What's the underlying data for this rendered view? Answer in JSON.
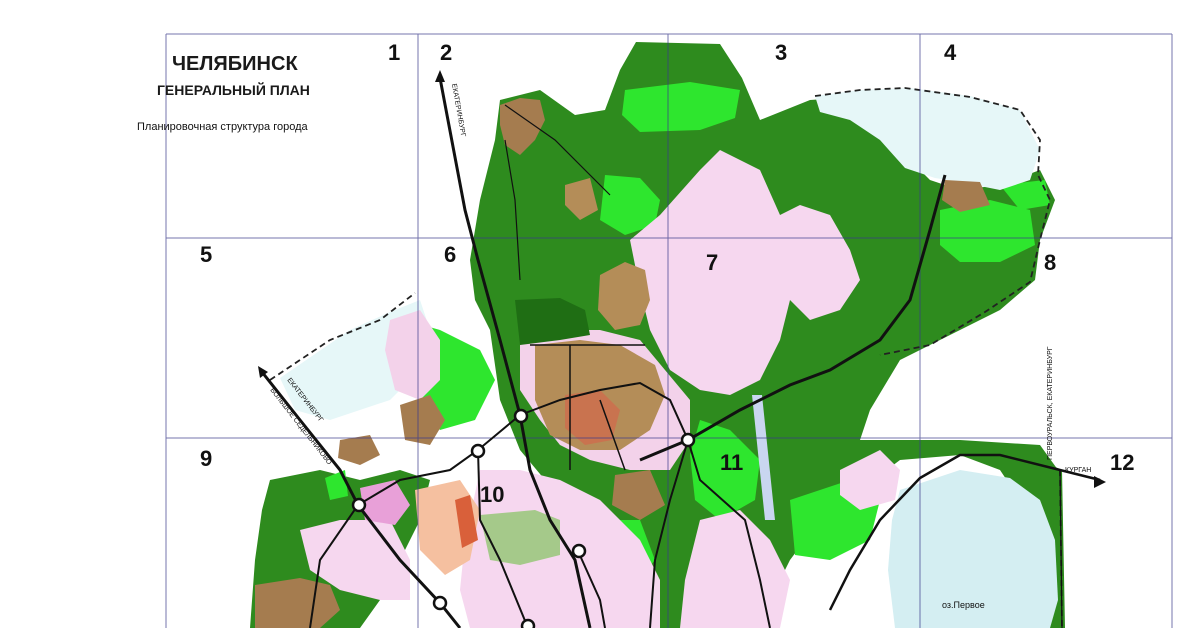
{
  "map": {
    "title": "ЧЕЛЯБИНСК",
    "subtitle": "ГЕНЕРАЛЬНЫЙ ПЛАН",
    "caption": "Планировочная структура города",
    "grid_cells": [
      "1",
      "2",
      "3",
      "4",
      "5",
      "6",
      "7",
      "8",
      "9",
      "10",
      "11",
      "12"
    ],
    "road_labels": {
      "ekaterinburg_north": "ЕКАТЕРИНБУРГ",
      "ekaterinburg_west": "ЕКАТЕРИНБУРГ",
      "bolshoe_sedelnikovo": "БОЛЬШОЕ СЕДЕЛЬНИКОВО",
      "pervouralsk": "ПЕРВОУРАЛЬСК, ЕКАТЕРИНБУРГ",
      "kurgan": "КУРГАН"
    },
    "lake_label": "оз.Первое",
    "colors": {
      "forest": "#2e8b1e",
      "park_light": "#2ee62e",
      "residential": "#f6d7ef",
      "industrial_pink": "#e8a0d8",
      "lake": "#d9f2f5",
      "brown": "#a57c4f",
      "grid": "#3a3a8a"
    }
  }
}
